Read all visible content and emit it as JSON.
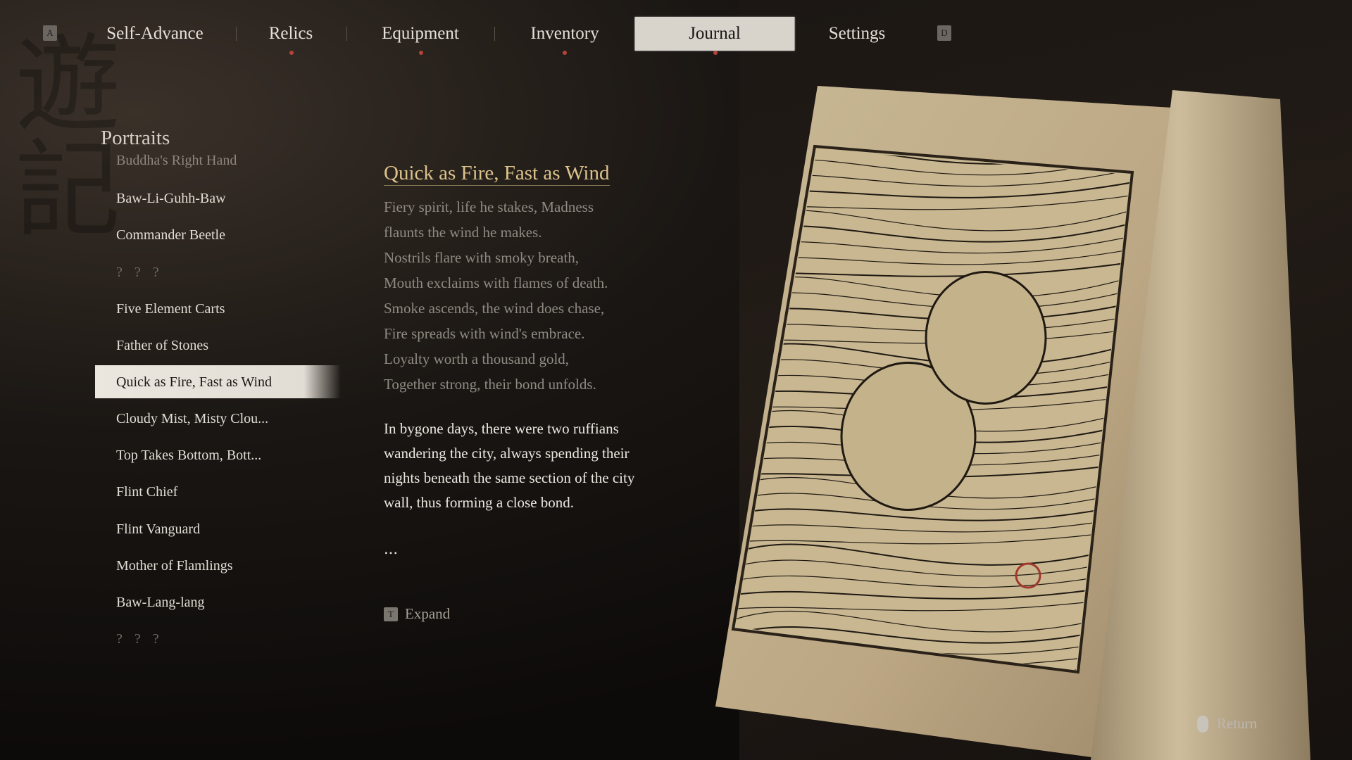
{
  "nav": {
    "left_key": "A",
    "right_key": "D",
    "tabs": [
      {
        "label": "Self-Advance",
        "active": false,
        "notify": false
      },
      {
        "label": "Relics",
        "active": false,
        "notify": true
      },
      {
        "label": "Equipment",
        "active": false,
        "notify": true
      },
      {
        "label": "Inventory",
        "active": false,
        "notify": true
      },
      {
        "label": "Journal",
        "active": true,
        "notify": true
      },
      {
        "label": "Settings",
        "active": false,
        "notify": false
      }
    ]
  },
  "section_title": "Portraits",
  "list": {
    "items": [
      "Buddha's Right Hand",
      "Baw-Li-Guhh-Baw",
      "Commander Beetle",
      "? ? ?",
      "Five Element Carts",
      "Father of Stones",
      "Quick as Fire, Fast as Wind",
      "Cloudy Mist, Misty Clou...",
      "Top Takes Bottom, Bott...",
      "Flint Chief",
      "Flint Vanguard",
      "Mother of Flamlings",
      "Baw-Lang-lang",
      "? ? ?"
    ],
    "selected_index": 6
  },
  "entry": {
    "title": "Quick as Fire, Fast as Wind",
    "poem": [
      "Fiery spirit, life he stakes, Madness",
      "flaunts the wind he makes.",
      "Nostrils flare with smoky breath,",
      "Mouth exclaims with flames of death.",
      "Smoke ascends, the wind does chase,",
      "Fire spreads with wind's embrace.",
      "Loyalty worth a thousand gold,",
      "Together strong, their bond unfolds."
    ],
    "prose": "In bygone days, there were two ruffians wandering the city, always spending their nights beneath the same section of the city wall, thus forming a close bond.",
    "ellipsis": "...",
    "expand_key": "T",
    "expand_label": "Expand"
  },
  "footer": {
    "return_label": "Return",
    "return_icon": "mouse-icon"
  },
  "colors": {
    "accent_gold": "#dcc38b",
    "notify_dot": "#b4443a",
    "paper": "#cdbb99"
  }
}
